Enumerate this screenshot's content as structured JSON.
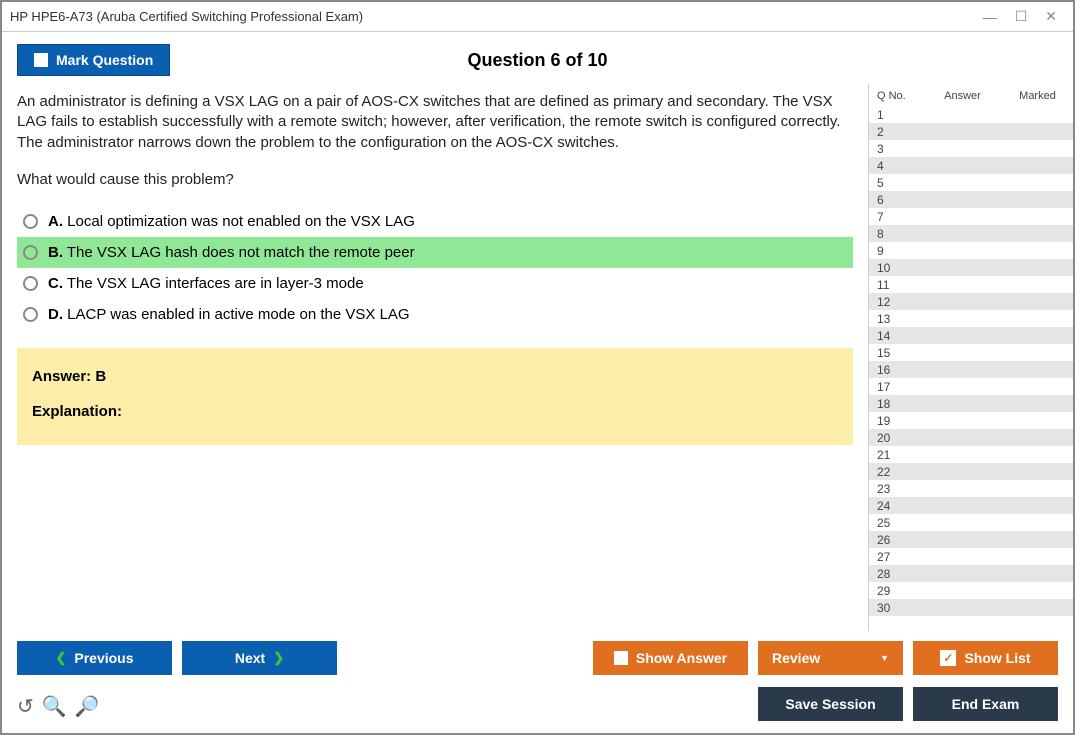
{
  "window": {
    "title": "HP HPE6-A73 (Aruba Certified Switching Professional Exam)"
  },
  "header": {
    "mark_label": "Mark Question",
    "question_title": "Question 6 of 10"
  },
  "question": {
    "text": "An administrator is defining a VSX LAG on a pair of AOS-CX switches that are defined as primary and secondary. The VSX LAG fails to establish successfully with a remote switch; however, after verification, the remote switch is configured correctly. The administrator narrows down the problem to the configuration on the AOS-CX switches.",
    "prompt": "What would cause this problem?",
    "options": [
      {
        "letter": "A.",
        "text": "Local optimization was not enabled on the VSX LAG",
        "selected": false
      },
      {
        "letter": "B.",
        "text": "The VSX LAG hash does not match the remote peer",
        "selected": true
      },
      {
        "letter": "C.",
        "text": "The VSX LAG interfaces are in layer-3 mode",
        "selected": false
      },
      {
        "letter": "D.",
        "text": "LACP was enabled in active mode on the VSX LAG",
        "selected": false
      }
    ],
    "answer_label": "Answer: B",
    "explanation_label": "Explanation:"
  },
  "sidebar": {
    "col_qno": "Q No.",
    "col_answer": "Answer",
    "col_marked": "Marked",
    "rows": [
      1,
      2,
      3,
      4,
      5,
      6,
      7,
      8,
      9,
      10,
      11,
      12,
      13,
      14,
      15,
      16,
      17,
      18,
      19,
      20,
      21,
      22,
      23,
      24,
      25,
      26,
      27,
      28,
      29,
      30
    ]
  },
  "footer": {
    "previous": "Previous",
    "next": "Next",
    "show_answer": "Show Answer",
    "review": "Review",
    "show_list": "Show List",
    "save_session": "Save Session",
    "end_exam": "End Exam"
  }
}
